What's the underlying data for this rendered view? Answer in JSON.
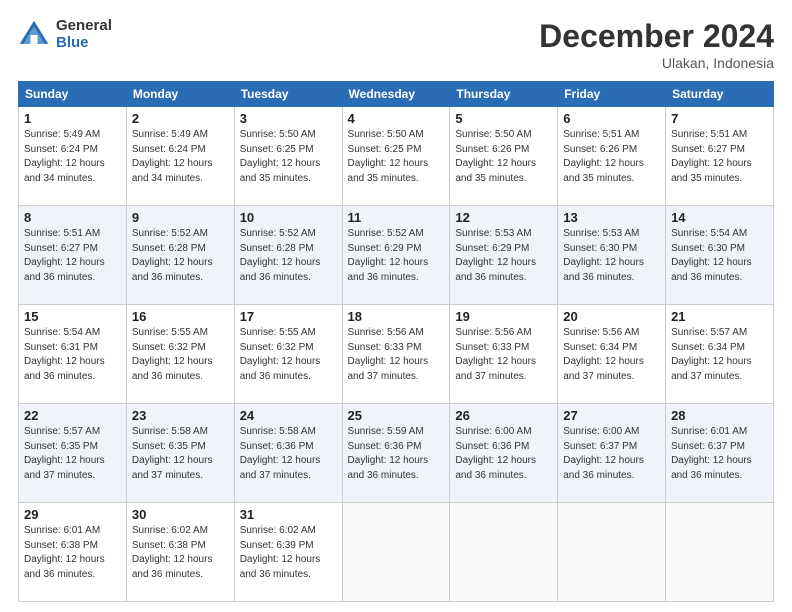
{
  "logo": {
    "general": "General",
    "blue": "Blue"
  },
  "title": "December 2024",
  "location": "Ulakan, Indonesia",
  "days_header": [
    "Sunday",
    "Monday",
    "Tuesday",
    "Wednesday",
    "Thursday",
    "Friday",
    "Saturday"
  ],
  "weeks": [
    [
      {
        "day": 1,
        "info": "Sunrise: 5:49 AM\nSunset: 6:24 PM\nDaylight: 12 hours\nand 34 minutes."
      },
      {
        "day": 2,
        "info": "Sunrise: 5:49 AM\nSunset: 6:24 PM\nDaylight: 12 hours\nand 34 minutes."
      },
      {
        "day": 3,
        "info": "Sunrise: 5:50 AM\nSunset: 6:25 PM\nDaylight: 12 hours\nand 35 minutes."
      },
      {
        "day": 4,
        "info": "Sunrise: 5:50 AM\nSunset: 6:25 PM\nDaylight: 12 hours\nand 35 minutes."
      },
      {
        "day": 5,
        "info": "Sunrise: 5:50 AM\nSunset: 6:26 PM\nDaylight: 12 hours\nand 35 minutes."
      },
      {
        "day": 6,
        "info": "Sunrise: 5:51 AM\nSunset: 6:26 PM\nDaylight: 12 hours\nand 35 minutes."
      },
      {
        "day": 7,
        "info": "Sunrise: 5:51 AM\nSunset: 6:27 PM\nDaylight: 12 hours\nand 35 minutes."
      }
    ],
    [
      {
        "day": 8,
        "info": "Sunrise: 5:51 AM\nSunset: 6:27 PM\nDaylight: 12 hours\nand 36 minutes."
      },
      {
        "day": 9,
        "info": "Sunrise: 5:52 AM\nSunset: 6:28 PM\nDaylight: 12 hours\nand 36 minutes."
      },
      {
        "day": 10,
        "info": "Sunrise: 5:52 AM\nSunset: 6:28 PM\nDaylight: 12 hours\nand 36 minutes."
      },
      {
        "day": 11,
        "info": "Sunrise: 5:52 AM\nSunset: 6:29 PM\nDaylight: 12 hours\nand 36 minutes."
      },
      {
        "day": 12,
        "info": "Sunrise: 5:53 AM\nSunset: 6:29 PM\nDaylight: 12 hours\nand 36 minutes."
      },
      {
        "day": 13,
        "info": "Sunrise: 5:53 AM\nSunset: 6:30 PM\nDaylight: 12 hours\nand 36 minutes."
      },
      {
        "day": 14,
        "info": "Sunrise: 5:54 AM\nSunset: 6:30 PM\nDaylight: 12 hours\nand 36 minutes."
      }
    ],
    [
      {
        "day": 15,
        "info": "Sunrise: 5:54 AM\nSunset: 6:31 PM\nDaylight: 12 hours\nand 36 minutes."
      },
      {
        "day": 16,
        "info": "Sunrise: 5:55 AM\nSunset: 6:32 PM\nDaylight: 12 hours\nand 36 minutes."
      },
      {
        "day": 17,
        "info": "Sunrise: 5:55 AM\nSunset: 6:32 PM\nDaylight: 12 hours\nand 36 minutes."
      },
      {
        "day": 18,
        "info": "Sunrise: 5:56 AM\nSunset: 6:33 PM\nDaylight: 12 hours\nand 37 minutes."
      },
      {
        "day": 19,
        "info": "Sunrise: 5:56 AM\nSunset: 6:33 PM\nDaylight: 12 hours\nand 37 minutes."
      },
      {
        "day": 20,
        "info": "Sunrise: 5:56 AM\nSunset: 6:34 PM\nDaylight: 12 hours\nand 37 minutes."
      },
      {
        "day": 21,
        "info": "Sunrise: 5:57 AM\nSunset: 6:34 PM\nDaylight: 12 hours\nand 37 minutes."
      }
    ],
    [
      {
        "day": 22,
        "info": "Sunrise: 5:57 AM\nSunset: 6:35 PM\nDaylight: 12 hours\nand 37 minutes."
      },
      {
        "day": 23,
        "info": "Sunrise: 5:58 AM\nSunset: 6:35 PM\nDaylight: 12 hours\nand 37 minutes."
      },
      {
        "day": 24,
        "info": "Sunrise: 5:58 AM\nSunset: 6:36 PM\nDaylight: 12 hours\nand 37 minutes."
      },
      {
        "day": 25,
        "info": "Sunrise: 5:59 AM\nSunset: 6:36 PM\nDaylight: 12 hours\nand 36 minutes."
      },
      {
        "day": 26,
        "info": "Sunrise: 6:00 AM\nSunset: 6:36 PM\nDaylight: 12 hours\nand 36 minutes."
      },
      {
        "day": 27,
        "info": "Sunrise: 6:00 AM\nSunset: 6:37 PM\nDaylight: 12 hours\nand 36 minutes."
      },
      {
        "day": 28,
        "info": "Sunrise: 6:01 AM\nSunset: 6:37 PM\nDaylight: 12 hours\nand 36 minutes."
      }
    ],
    [
      {
        "day": 29,
        "info": "Sunrise: 6:01 AM\nSunset: 6:38 PM\nDaylight: 12 hours\nand 36 minutes."
      },
      {
        "day": 30,
        "info": "Sunrise: 6:02 AM\nSunset: 6:38 PM\nDaylight: 12 hours\nand 36 minutes."
      },
      {
        "day": 31,
        "info": "Sunrise: 6:02 AM\nSunset: 6:39 PM\nDaylight: 12 hours\nand 36 minutes."
      },
      null,
      null,
      null,
      null
    ]
  ]
}
